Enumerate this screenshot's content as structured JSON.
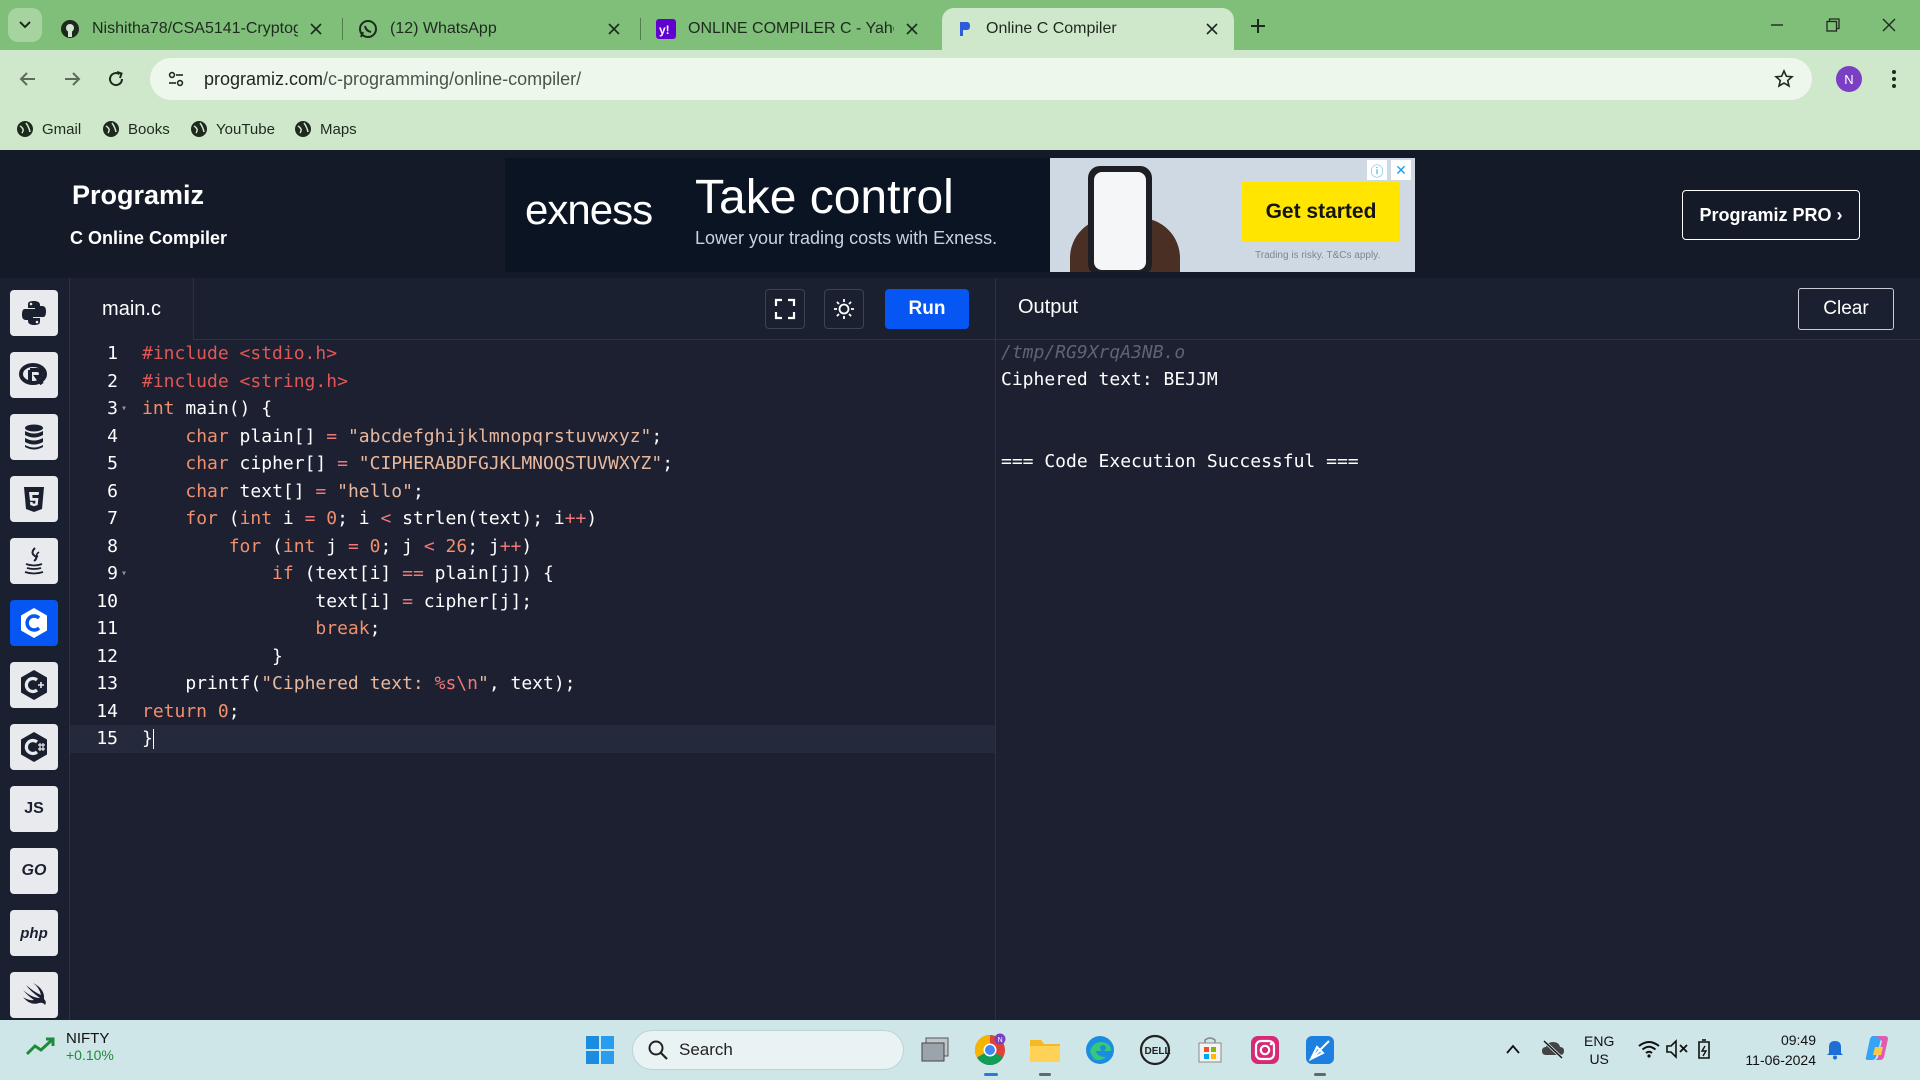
{
  "browser": {
    "tabs": [
      {
        "label": "Nishitha78/CSA5141-Cryptogra",
        "favicon": "github-icon"
      },
      {
        "label": "(12) WhatsApp",
        "favicon": "whatsapp-icon"
      },
      {
        "label": "ONLINE COMPILER C - Yahoo In",
        "favicon": "yahoo-icon"
      },
      {
        "label": "Online C Compiler",
        "favicon": "programiz-icon",
        "active": true
      }
    ],
    "url_host": "programiz.com",
    "url_path": "/c-programming/online-compiler/",
    "profile_initial": "N",
    "bookmarks": [
      "Gmail",
      "Books",
      "YouTube",
      "Maps"
    ]
  },
  "site": {
    "logo": "Programiz",
    "subtitle": "C Online Compiler",
    "pro_button": "Programiz PRO ›"
  },
  "ad": {
    "brand": "exness",
    "headline": "Take control",
    "subline": "Lower your trading costs with Exness.",
    "cta": "Get started",
    "disclaimer": "Trading is risky. T&Cs apply."
  },
  "sidebar": {
    "languages": [
      "python",
      "r",
      "sql",
      "html",
      "java",
      "c",
      "cpp",
      "csharp",
      "JS",
      "GO",
      "php",
      "swift"
    ],
    "active": "c"
  },
  "editor": {
    "file_name": "main.c",
    "run_label": "Run",
    "lines": [
      "1",
      "2",
      "3",
      "4",
      "5",
      "6",
      "7",
      "8",
      "9",
      "10",
      "11",
      "12",
      "13",
      "14",
      "15"
    ]
  },
  "output": {
    "title": "Output",
    "clear_label": "Clear",
    "lines": [
      "/tmp/RG9XrqA3NB.o",
      "Ciphered text: BEJJM",
      "",
      "=== Code Execution Successful ==="
    ]
  },
  "taskbar": {
    "ticker_name": "NIFTY",
    "ticker_value": "+0.10%",
    "search_placeholder": "Search",
    "lang_top": "ENG",
    "lang_bottom": "US",
    "time": "09:49",
    "date": "11-06-2024"
  },
  "colors": {
    "run_blue": "#0556f3",
    "editor_bg": "#1c2030",
    "chrome_green": "#7fbf7a"
  }
}
